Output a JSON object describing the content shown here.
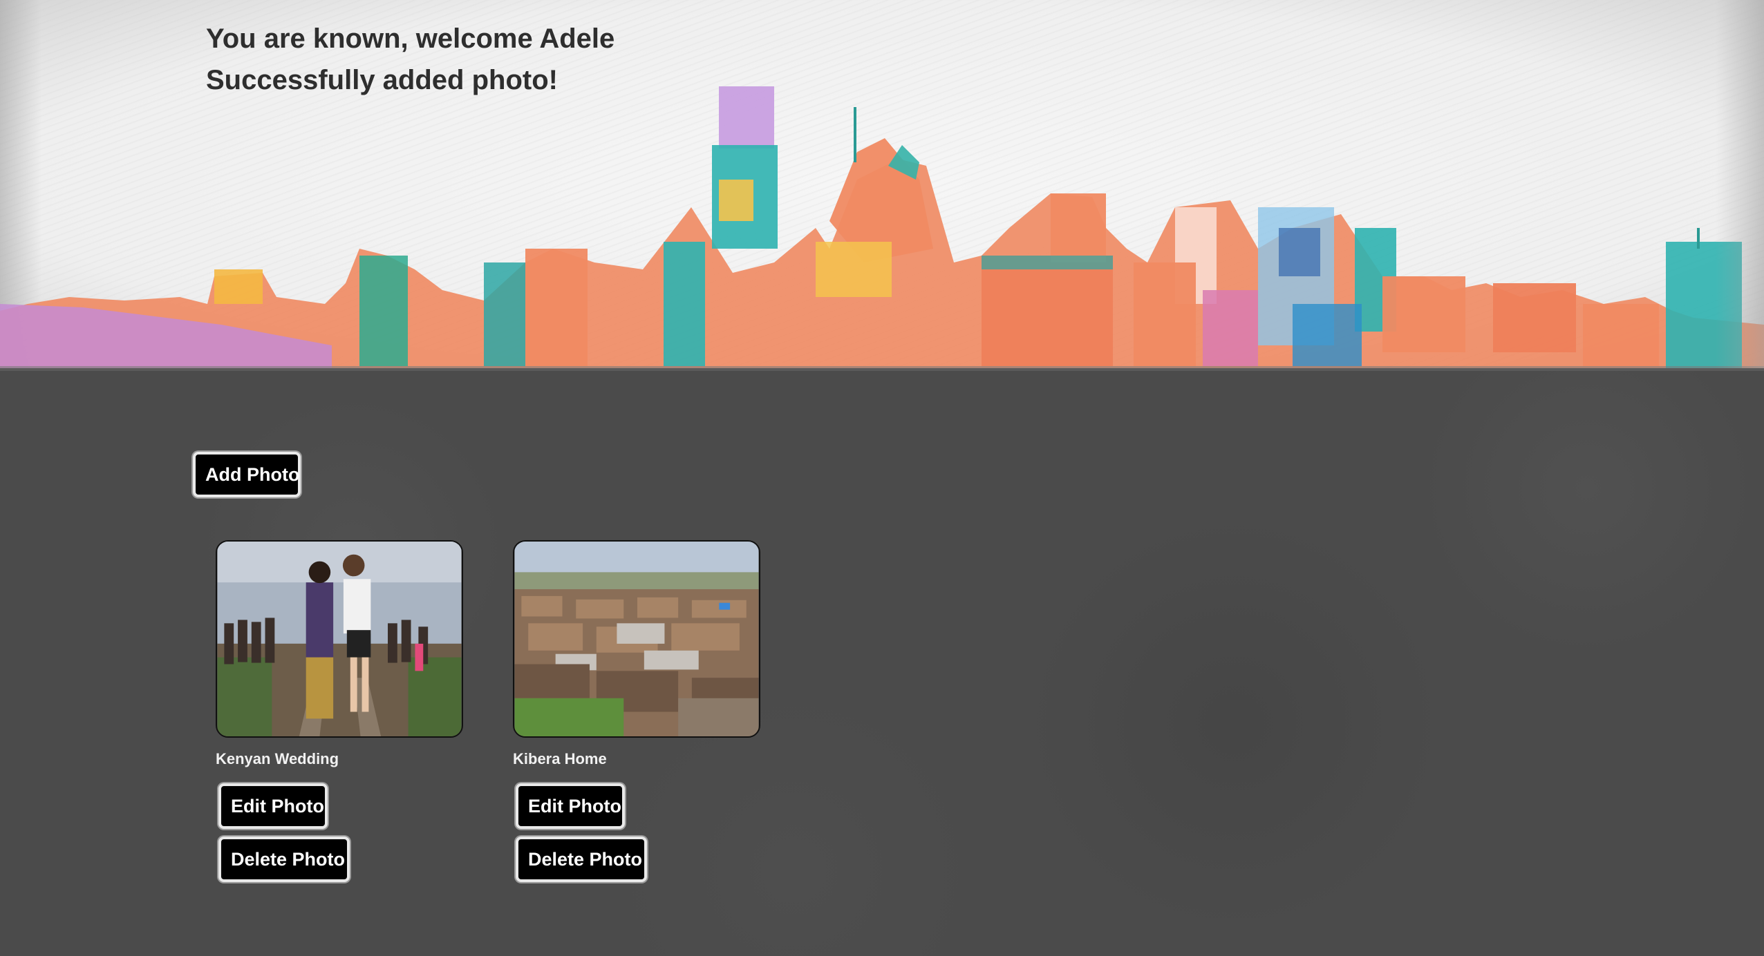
{
  "header": {
    "welcome_text": "You are known, welcome Adele",
    "flash_message": "Successfully added photo!",
    "banner_image": "watercolor-city-skyline"
  },
  "main": {
    "add_photo_label": "Add Photo",
    "photos": [
      {
        "title": "Kenyan Wedding",
        "image": "couple-kissing-on-railway-tracks-with-children",
        "edit_label": "Edit Photo",
        "delete_label": "Delete Photo"
      },
      {
        "title": "Kibera Home",
        "image": "tin-roofed-settlement-aerial-view",
        "edit_label": "Edit Photo",
        "delete_label": "Delete Photo"
      }
    ]
  },
  "colors": {
    "main_background": "#4b4b4b",
    "button_background": "#000000",
    "button_border": "#e9e9e9",
    "header_text": "#2e2e2e",
    "caption_text": "#f2f2f2"
  }
}
